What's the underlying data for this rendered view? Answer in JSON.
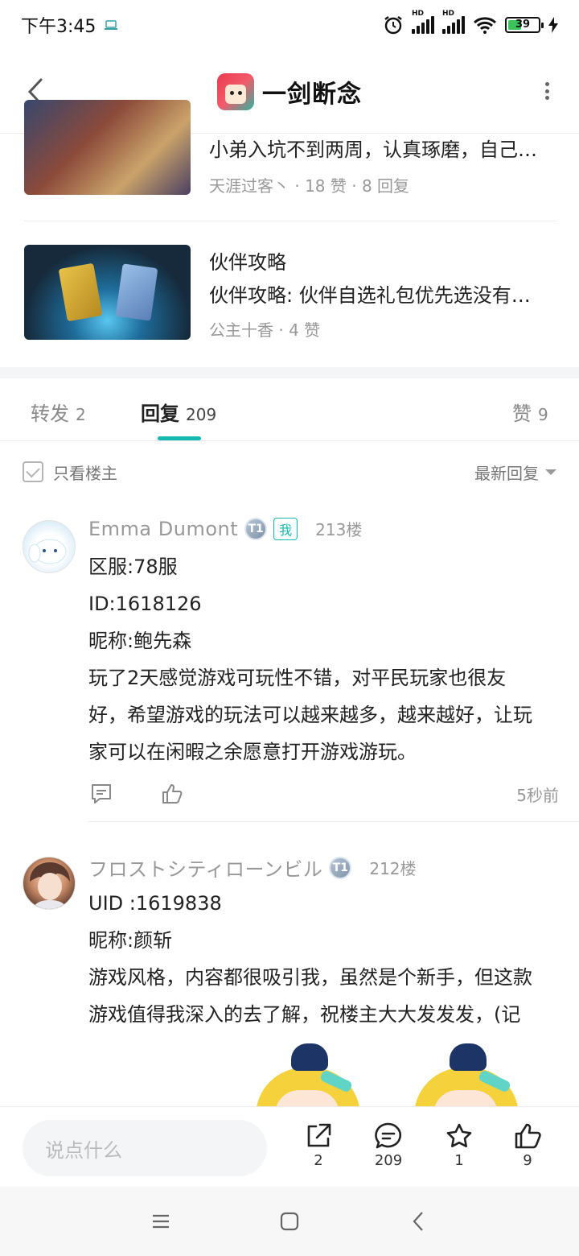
{
  "status_bar": {
    "time": "下午3:45",
    "battery": "39"
  },
  "header": {
    "game_title": "一剑断念"
  },
  "related_posts": [
    {
      "title": "小弟入坑不到两周，认真琢磨，自己…",
      "meta": "天涯过客丶 · 18 赞 · 8 回复"
    },
    {
      "title": "伙伴攻略",
      "subtitle": "伙伴攻略: 伙伴自选礼包优先选没有…",
      "meta": "公主十香 · 4 赞"
    }
  ],
  "tabs": [
    {
      "label": "转发",
      "count": "2"
    },
    {
      "label": "回复",
      "count": "209"
    },
    {
      "label": "赞",
      "count": "9"
    }
  ],
  "filter": {
    "only_op_label": "只看楼主",
    "sort_label": "最新回复"
  },
  "comments": [
    {
      "nickname": "Emma  Dumont",
      "level_badge": "T1",
      "me_tag": "我",
      "floor": "213楼",
      "lines": [
        "区服:78服",
        "ID:1618126",
        "昵称:鲍先森",
        "玩了2天感觉游戏可玩性不错，对平民玩家也很友",
        "好，希望游戏的玩法可以越来越多，越来越好，让玩",
        "家可以在闲暇之余愿意打开游戏游玩。"
      ],
      "time": "5秒前"
    },
    {
      "nickname": "フロストシティローンビル",
      "level_badge": "T1",
      "floor": "212楼",
      "lines": [
        "UID :1619838",
        "昵称:颜斩",
        "游戏风格，内容都很吸引我，虽然是个新手，但这款",
        "游戏值得我深入的去了解，祝楼主大大发发发，(记"
      ]
    }
  ],
  "bottom_bar": {
    "input_placeholder": "说点什么",
    "share_count": "2",
    "comment_count": "209",
    "favorite_count": "1",
    "like_count": "9"
  },
  "colors": {
    "accent": "#14b9b4",
    "muted_text": "#999999"
  }
}
